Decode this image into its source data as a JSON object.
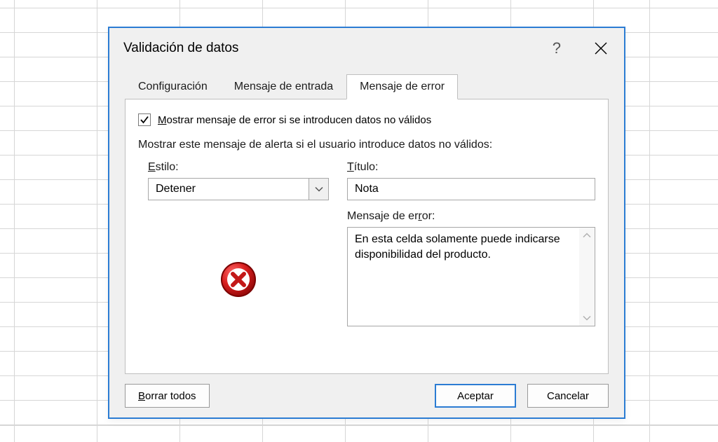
{
  "dialog": {
    "title": "Validación de datos",
    "help_symbol": "?",
    "tabs": {
      "config": "Configuración",
      "input_msg": "Mensaje de entrada",
      "error_msg": "Mensaje de error"
    },
    "checkbox": {
      "pre": "M",
      "rest": "ostrar mensaje de error si se introducen datos no válidos"
    },
    "group_text": "Mostrar este mensaje de alerta si el usuario introduce datos no válidos:",
    "style": {
      "label_pre": "E",
      "label_rest": "stilo:",
      "value": "Detener"
    },
    "title_field": {
      "label_pre": "T",
      "label_rest": "ítulo:",
      "value": "Nota"
    },
    "error_field": {
      "label_full": "Mensaje de er",
      "label_u": "r",
      "label_after": "or:",
      "value": "En esta celda solamente puede indicarse disponibilidad del producto."
    },
    "buttons": {
      "clear_pre": "B",
      "clear_rest": "orrar todos",
      "accept": "Aceptar",
      "cancel": "Cancelar"
    }
  }
}
